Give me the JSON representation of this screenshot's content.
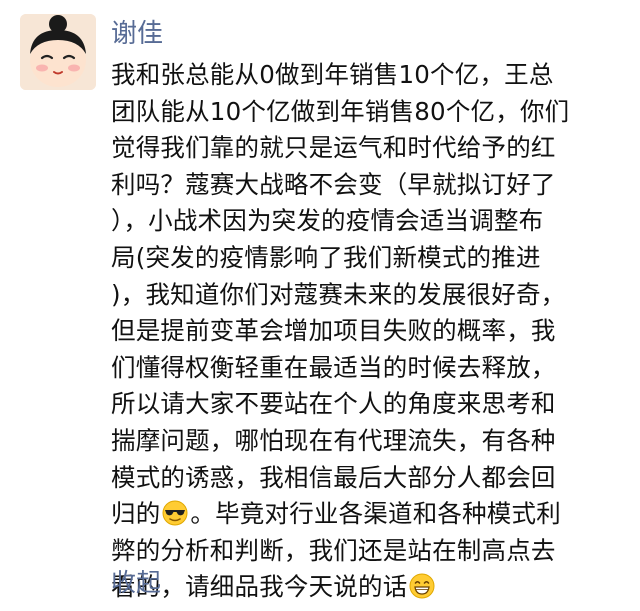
{
  "post": {
    "author": "谢佳",
    "lines": [
      "我和张总能从0做到年销售10个亿，王总",
      "团队能从10个亿做到年销售80个亿，你们",
      "觉得我们靠的就只是运气和时代给予的红",
      "利吗？蔻赛大战略不会变（早就拟订好了",
      "），小战术因为突发的疫情会适当调整布",
      "局(突发的疫情影响了我们新模式的推进",
      ")，我知道你们对蔻赛未来的发展很好奇，",
      "但是提前变革会增加项目失败的概率，我",
      "们懂得权衡轻重在最适当的时候去释放，",
      "所以请大家不要站在个人的角度来思考和",
      "揣摩问题，哪怕现在有代理流失，有各种",
      "模式的诱惑，我相信最后大部分人都会回"
    ],
    "line13_before": "归的",
    "line13_after": "。毕竟对行业各渠道和各种模式利",
    "line14": "弊的分析和判断，我们还是站在制高点去",
    "line15": "看的，请细品我今天说的话",
    "emoji_1": "sunglasses-emoji",
    "emoji_2": "grin-emoji",
    "collapse_label": "收起",
    "colors": {
      "link": "#576b95",
      "text": "#111111"
    }
  }
}
